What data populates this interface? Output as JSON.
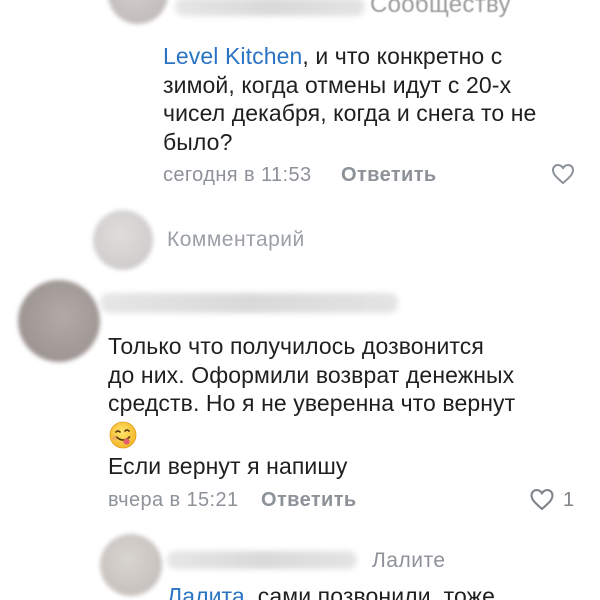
{
  "comment1": {
    "header_fragment": "Сообществу",
    "mention": "Level Kitchen",
    "text_lines": [
      ", и что конкретно с",
      "зимой, когда отмены идут с 20-х",
      "чисел декабря, когда и снега то не",
      "было?"
    ],
    "time": "сегодня в 11:53",
    "reply_label": "Ответить",
    "icon_like": "heart-outline-icon"
  },
  "comment_input": {
    "placeholder": "Комментарий"
  },
  "comment2": {
    "text_lines": [
      "Только что получилось дозвонится",
      "до них. Оформили возврат денежных",
      "средств. Но я не уверенна что вернут"
    ],
    "emoji": "smiling-face-with-tongue",
    "last_line": "Если вернут я напишу",
    "time": "вчера в 15:21",
    "reply_label": "Ответить",
    "likes": "1",
    "icon_like": "heart-outline-icon"
  },
  "comment3": {
    "reply_to": "Лалите",
    "mention": "Лалита",
    "text_fragment": ", сами позвонили, тоже"
  },
  "colors": {
    "link": "#2a74c3",
    "meta": "#8d9299",
    "text": "#1f1f1f"
  }
}
